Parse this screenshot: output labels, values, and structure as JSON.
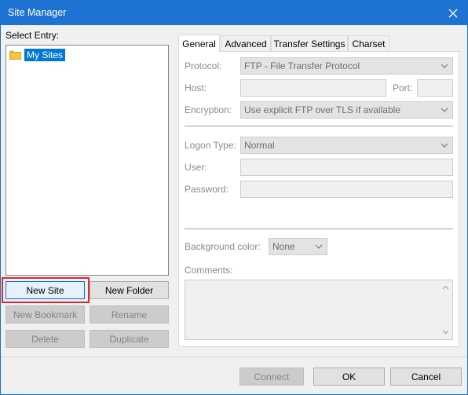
{
  "window": {
    "title": "Site Manager"
  },
  "left": {
    "select_entry_label": "Select Entry:",
    "tree": [
      {
        "label": "My Sites",
        "icon": "folder-icon"
      }
    ],
    "buttons": {
      "new_site": "New Site",
      "new_folder": "New Folder",
      "new_bookmark": "New Bookmark",
      "rename": "Rename",
      "delete": "Delete",
      "duplicate": "Duplicate"
    }
  },
  "tabs": [
    "General",
    "Advanced",
    "Transfer Settings",
    "Charset"
  ],
  "general": {
    "protocol_label": "Protocol:",
    "protocol_value": "FTP - File Transfer Protocol",
    "host_label": "Host:",
    "host_value": "",
    "port_label": "Port:",
    "port_value": "",
    "encryption_label": "Encryption:",
    "encryption_value": "Use explicit FTP over TLS if available",
    "logon_type_label": "Logon Type:",
    "logon_type_value": "Normal",
    "user_label": "User:",
    "user_value": "",
    "password_label": "Password:",
    "password_value": "",
    "bg_color_label": "Background color:",
    "bg_color_value": "None",
    "comments_label": "Comments:",
    "comments_value": ""
  },
  "footer": {
    "connect": "Connect",
    "ok": "OK",
    "cancel": "Cancel"
  },
  "colors": {
    "titlebar": "#1e73d2",
    "selection": "#0078d7",
    "highlight": "#e4262e"
  }
}
